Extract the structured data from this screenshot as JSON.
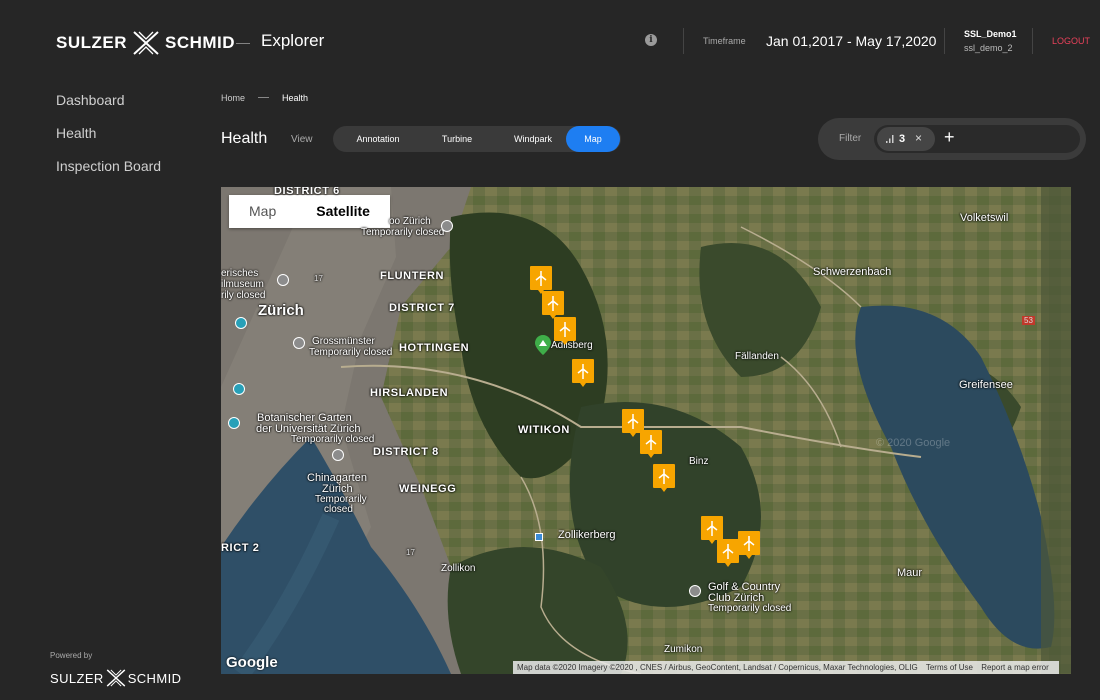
{
  "header": {
    "brand_left": "SULZER",
    "brand_right": "SCHMID",
    "separator": "—",
    "app_title": "Explorer",
    "timeframe_label": "Timeframe",
    "timeframe_value": "Jan 01,2017 - May 17,2020",
    "user_name": "SSL_Demo1",
    "user_sub": "ssl_demo_2",
    "logout": "LOGOUT"
  },
  "sidebar": {
    "items": [
      {
        "label": "Dashboard"
      },
      {
        "label": "Health"
      },
      {
        "label": "Inspection Board"
      }
    ],
    "powered_by": "Powered by",
    "brand_left": "SULZER",
    "brand_right": "SCHMID"
  },
  "breadcrumb": {
    "home": "Home",
    "current": "Health"
  },
  "toolbar": {
    "title": "Health",
    "view_label": "View",
    "tabs": [
      {
        "label": "Annotation",
        "active": false
      },
      {
        "label": "Turbine",
        "active": false
      },
      {
        "label": "Windpark",
        "active": false
      },
      {
        "label": "Map",
        "active": true
      }
    ],
    "filter_label": "Filter",
    "filter_count": "3",
    "filter_close": "×",
    "add_filter": "+"
  },
  "map": {
    "toggle": [
      {
        "label": "Map",
        "active": false
      },
      {
        "label": "Satellite",
        "active": true
      }
    ],
    "places": {
      "district6": "DISTRICT 6",
      "zoo": "oo Zürich",
      "zoo_sub": "Temporarily closed",
      "museum1": "erisches",
      "museum2": "ilmuseum",
      "museum3": "rily closed",
      "zurich": "Zürich",
      "fluntern": "FLUNTERN",
      "district7": "DISTRICT 7",
      "grossmunster": "Grossmünster",
      "grossmunster_sub": "Temporarily closed",
      "hottingen": "HOTTINGEN",
      "adlisberg": "Adlisberg",
      "hirslanden": "HIRSLANDEN",
      "botanic1": "Botanischer Garten",
      "botanic2": "der Universität Zürich",
      "botanic3": "Temporarily closed",
      "witikon": "WITIKON",
      "district8": "DISTRICT 8",
      "chinagarten1": "Chinagarten",
      "chinagarten2": "Zürich",
      "chinagarten3": "Temporarily",
      "chinagarten4": "closed",
      "weinegg": "WEINEGG",
      "rict2": "RICT 2",
      "zollikerberg": "Zollikerberg",
      "zollikon": "Zollikon",
      "golf1": "Golf & Country",
      "golf2": "Club Zürich",
      "golf3": "Temporarily closed",
      "zumikon": "Zumikon",
      "binz": "Binz",
      "fallanden": "Fällanden",
      "schwerzenbach": "Schwerzenbach",
      "volketswil": "Volketswil",
      "greifensee": "Greifensee",
      "maur": "Maur",
      "road17": "17",
      "road53": "53"
    },
    "google": "Google",
    "watermark": "© 2020 Google",
    "attribution": "Map data ©2020 Imagery ©2020 , CNES / Airbus, GeoContent, Landsat / Copernicus, Maxar Technologies, OLIG",
    "terms": "Terms of Use",
    "report": "Report a map error"
  },
  "colors": {
    "accent": "#1e7ef2",
    "turbine": "#f7a500",
    "logout": "#e8415a",
    "background": "#262626"
  }
}
